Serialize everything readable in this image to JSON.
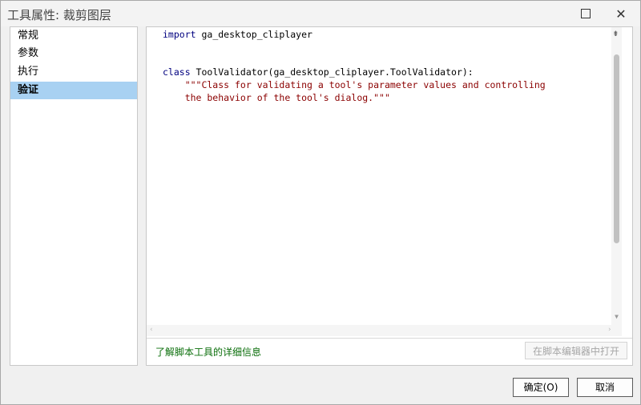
{
  "window": {
    "title": "工具属性: 裁剪图层",
    "maximize_glyph": "□",
    "close_glyph": "✕"
  },
  "sidebar": {
    "items": [
      {
        "label": "常规",
        "selected": false
      },
      {
        "label": "参数",
        "selected": false
      },
      {
        "label": "执行",
        "selected": false
      },
      {
        "label": "验证",
        "selected": true
      }
    ]
  },
  "editor": {
    "lines": [
      {
        "kw": "import",
        "rest": " ga_desktop_cliplayer"
      },
      {
        "kw": "class",
        "rest": " ToolValidator(ga_desktop_cliplayer.ToolValidator):"
      },
      {
        "str": "    \"\"\"Class for validating a tool's parameter values and controlling"
      },
      {
        "str": "    the behavior of the tool's dialog.\"\"\""
      }
    ],
    "split_icon": "split-handle-icon",
    "split_glyph": "⇟"
  },
  "footer": {
    "help_link": "了解脚本工具的详细信息",
    "open_in_editor": "在脚本编辑器中打开"
  },
  "buttons": {
    "ok": "确定(O)",
    "cancel": "取消"
  },
  "colors": {
    "keyword": "#00007f",
    "string": "#8b0000",
    "selection": "#a8d1f2",
    "link": "#0a6e0a"
  }
}
